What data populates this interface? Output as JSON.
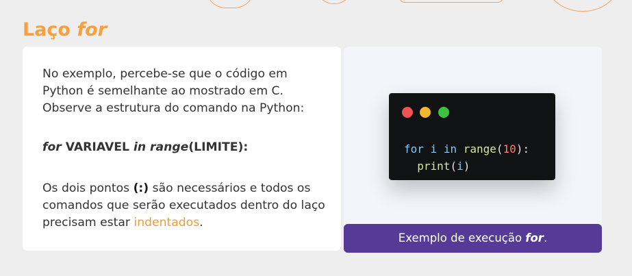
{
  "title": {
    "prefix": "Laço ",
    "emphasis": "for"
  },
  "text_card": {
    "paragraph1": "No exemplo, percebe-se que o código em Python é semelhante ao mostrado em C. Observe a estrutura do comando na Python:",
    "syntax": {
      "kw_for": "for",
      "variable": " VARIAVEL ",
      "kw_in_range": "in range",
      "limit": "(LIMITE):"
    },
    "paragraph3": {
      "before": "Os dois pontos ",
      "colon": "(:)",
      "middle": " são necessários e todos os comandos que serão executados dentro do laço precisam estar ",
      "highlight": "indentados",
      "after": "."
    }
  },
  "code_window": {
    "line1": {
      "kw_for": "for",
      "var_i": "i",
      "kw_in": "in",
      "fn_range": "range",
      "open": "(",
      "number": "10",
      "close": "):"
    },
    "line2": {
      "fn_print": "print",
      "open": "(",
      "var_i": "i",
      "close": ")"
    }
  },
  "caption": {
    "prefix": "Exemplo de execução ",
    "emphasis": "for",
    "suffix": "."
  },
  "colors": {
    "accent_orange": "#f6a040",
    "caption_purple": "#553b97",
    "code_bg": "#101213"
  }
}
